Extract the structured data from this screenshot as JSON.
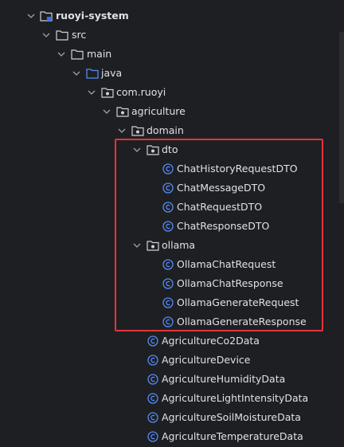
{
  "tree": {
    "rows": [
      {
        "label": "ruoyi-system",
        "icon": "module-folder-icon"
      },
      {
        "label": "src",
        "icon": "folder-icon"
      },
      {
        "label": "main",
        "icon": "folder-icon"
      },
      {
        "label": "java",
        "icon": "source-root-folder-icon"
      },
      {
        "label": "com.ruoyi",
        "icon": "package-icon"
      },
      {
        "label": "agriculture",
        "icon": "package-icon"
      },
      {
        "label": "domain",
        "icon": "package-icon"
      },
      {
        "label": "dto",
        "icon": "package-icon"
      },
      {
        "label": "ChatHistoryRequestDTO",
        "icon": "class-icon"
      },
      {
        "label": "ChatMessageDTO",
        "icon": "class-icon"
      },
      {
        "label": "ChatRequestDTO",
        "icon": "class-icon"
      },
      {
        "label": "ChatResponseDTO",
        "icon": "class-icon"
      },
      {
        "label": "ollama",
        "icon": "package-icon"
      },
      {
        "label": "OllamaChatRequest",
        "icon": "class-icon"
      },
      {
        "label": "OllamaChatResponse",
        "icon": "class-icon"
      },
      {
        "label": "OllamaGenerateRequest",
        "icon": "class-icon"
      },
      {
        "label": "OllamaGenerateResponse",
        "icon": "class-icon"
      },
      {
        "label": "AgricultureCo2Data",
        "icon": "class-icon"
      },
      {
        "label": "AgricultureDevice",
        "icon": "class-icon"
      },
      {
        "label": "AgricultureHumidityData",
        "icon": "class-icon"
      },
      {
        "label": "AgricultureLightIntensityData",
        "icon": "class-icon"
      },
      {
        "label": "AgricultureSoilMoistureData",
        "icon": "class-icon"
      },
      {
        "label": "AgricultureTemperatureData",
        "icon": "class-icon"
      }
    ]
  },
  "colors": {
    "background": "#1e1f22",
    "text": "#dfe1e5",
    "highlight": "#e0353b",
    "class_icon": "#3574f0"
  }
}
